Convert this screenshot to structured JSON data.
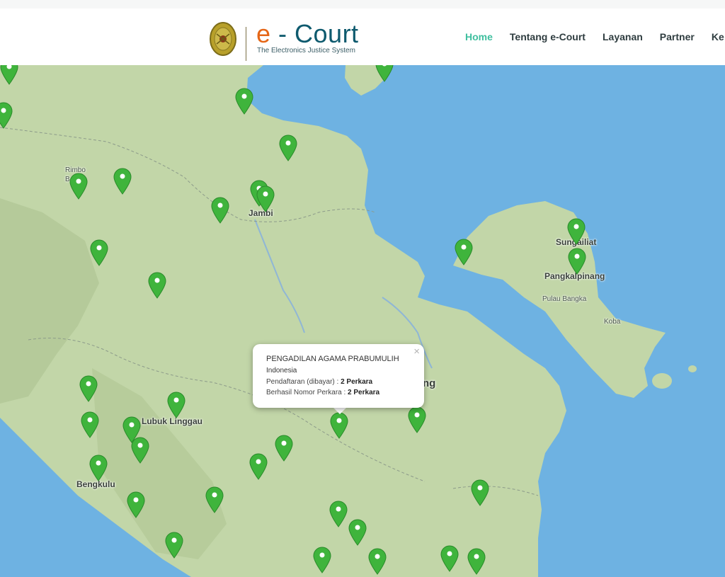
{
  "header": {
    "logo_prefix": "e",
    "logo_rest": " - Court",
    "tagline": "The Electronics Justice System",
    "emblem_icon": "court-emblem-icon"
  },
  "nav": {
    "items": [
      "Home",
      "Tentang e-Court",
      "Layanan",
      "Partner",
      "Ke"
    ],
    "active": "Home",
    "active_color": "#3fbf9f"
  },
  "map": {
    "sea_color": "#6eb2e2",
    "land_color": "#c2d6a8",
    "marker_color": "#3fb43c",
    "labels": {
      "rimbo": "Rimbo",
      "bungo": "B",
      "jambi": "Jambi",
      "sungailiat": "Sungailiat",
      "pangkalpinang": "Pangkalpinang",
      "pulau_bangka": "Pulau Bangka",
      "koba": "Koba",
      "lubuk_linggau": "Lubuk Linggau",
      "bengkulu": "Bengkulu",
      "palembang_partial": "ng"
    }
  },
  "popup": {
    "title": "PENGADILAN AGAMA PRABUMULIH",
    "country": "Indonesia",
    "registered_label": "Pendaftaran (dibayar) : ",
    "registered_value": "2 Perkara",
    "success_label": "Berhasil Nomor Perkara : ",
    "success_value": "2 Perkara",
    "close_symbol": "×"
  }
}
